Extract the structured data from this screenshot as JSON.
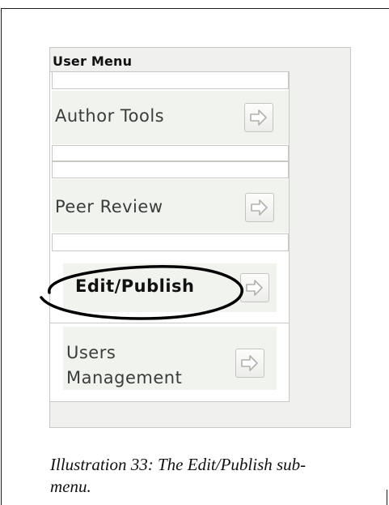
{
  "user_menu": {
    "title": "User Menu",
    "items": [
      {
        "label": "Author Tools",
        "highlighted": false
      },
      {
        "label": "Peer Review",
        "highlighted": false
      },
      {
        "label": "Edit/Publish",
        "highlighted": true
      },
      {
        "label_line1": "Users",
        "label_line2": "Management",
        "highlighted": false
      }
    ],
    "arrow_icon": "right-arrow-icon"
  },
  "caption": {
    "text": "Illustration 33: The Edit/Publish sub-",
    "text_line2": "menu."
  },
  "colors": {
    "panel_bg": "#f0f0ee",
    "item_bg": "#f1f3ef",
    "border": "#c8c8c4",
    "highlight": "#111111"
  }
}
